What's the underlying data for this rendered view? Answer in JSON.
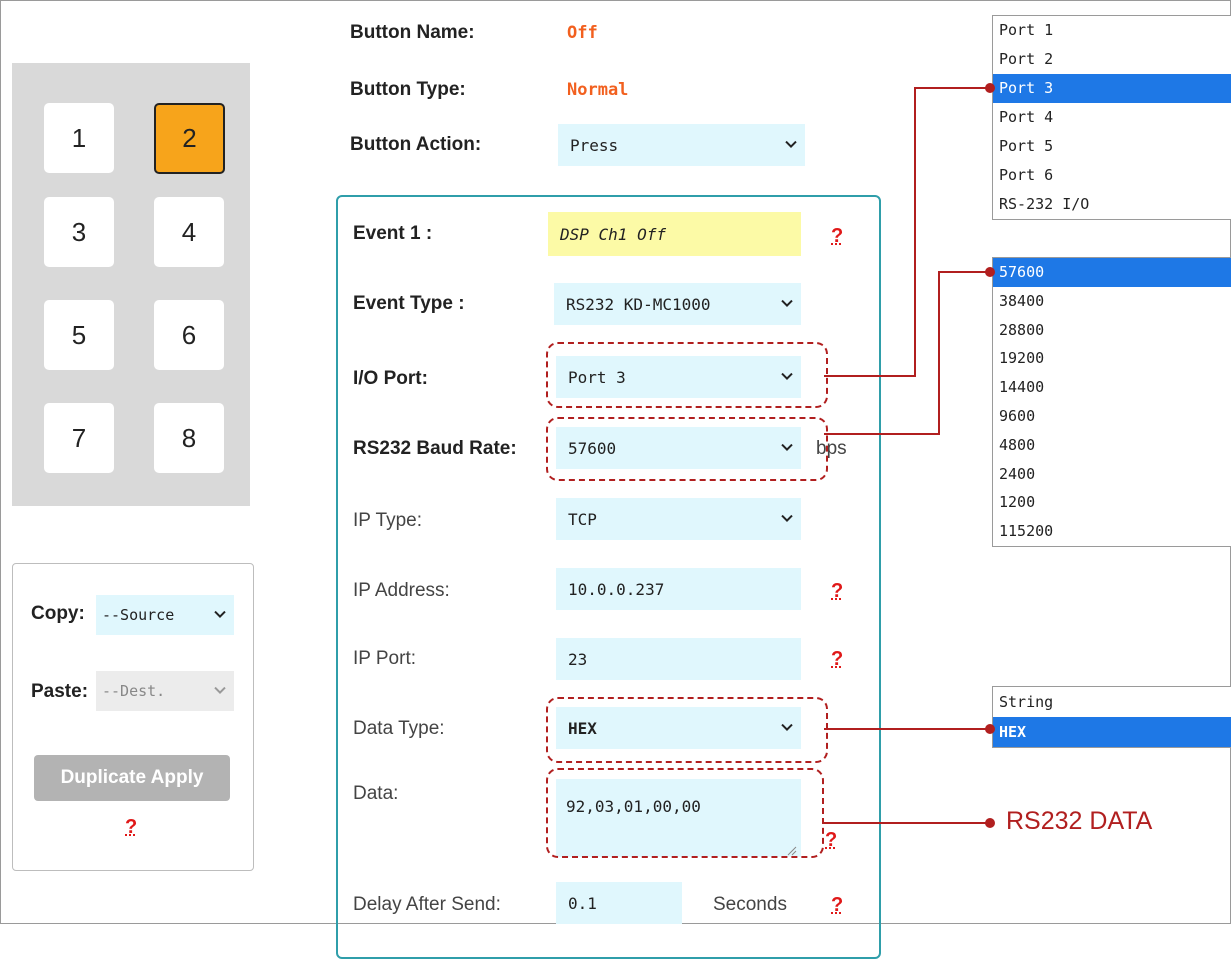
{
  "keypad": {
    "keys": [
      "1",
      "2",
      "3",
      "4",
      "5",
      "6",
      "7",
      "8"
    ],
    "active": "2"
  },
  "copy": {
    "copy_label": "Copy:",
    "copy_value": "--Source",
    "paste_label": "Paste:",
    "paste_value": "--Dest.",
    "duplicate_label": "Duplicate Apply",
    "help": "?"
  },
  "button": {
    "name_label": "Button Name:",
    "name_value": "Off",
    "type_label": "Button Type:",
    "type_value": "Normal",
    "action_label": "Button Action:",
    "action_value": "Press"
  },
  "event": {
    "event_label": "Event 1 :",
    "event_value": "DSP Ch1 Off",
    "type_label": "Event Type :",
    "type_value": "RS232 KD-MC1000",
    "io_label": "I/O Port:",
    "io_value": "Port 3",
    "baud_label": "RS232 Baud Rate:",
    "baud_value": "57600",
    "baud_unit": "bps",
    "iptype_label": "IP Type:",
    "iptype_value": "TCP",
    "ipaddr_label": "IP Address:",
    "ipaddr_value": "10.0.0.237",
    "ipport_label": "IP Port:",
    "ipport_value": "23",
    "datatype_label": "Data Type:",
    "datatype_value": "HEX",
    "data_label": "Data:",
    "data_value": "92,03,01,00,00",
    "delay_label": "Delay After Send:",
    "delay_value": "0.1",
    "delay_unit": "Seconds",
    "help": "?"
  },
  "port_list": {
    "items": [
      "Port 1",
      "Port 2",
      "Port 3",
      "Port 4",
      "Port 5",
      "Port 6",
      "RS-232 I/O"
    ],
    "selected": "Port 3"
  },
  "baud_list": {
    "items": [
      "57600",
      "38400",
      "28800",
      "19200",
      "14400",
      "9600",
      "4800",
      "2400",
      "1200",
      "115200"
    ],
    "selected": "57600"
  },
  "datatype_list": {
    "items": [
      "String",
      "HEX"
    ],
    "selected": "HEX"
  },
  "annotation": {
    "rs232_label": "RS232 DATA"
  },
  "colors": {
    "accent_orange": "#f7a41b",
    "annotation_red": "#b11f1f",
    "field_bg": "#e0f7fd",
    "highlight_blue": "#1e78e6",
    "panel_border": "#2f9eaa"
  }
}
